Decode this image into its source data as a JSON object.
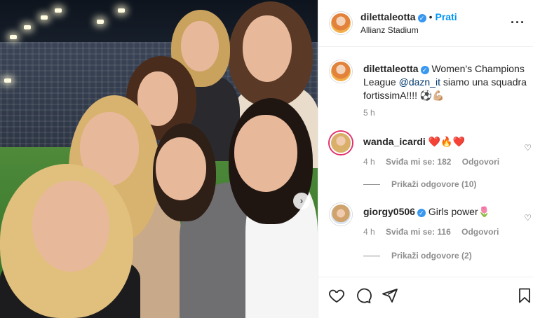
{
  "post": {
    "username": "dilettaleotta",
    "follow_label": "Prati",
    "location": "Allianz Stadium"
  },
  "caption": {
    "username": "dilettaleotta",
    "text_before": "Women's Champions League ",
    "mention": "@dazn_it",
    "text_after": " siamo una squadra fortissimA!!!! ⚽💪🏼",
    "time": "5 h"
  },
  "comments": [
    {
      "username": "wanda_icardi",
      "text": "❤️🔥❤️",
      "time": "4 h",
      "likes_label": "Sviđa mi se: 182",
      "reply_label": "Odgovori",
      "view_replies": "Prikaži odgovore (10)"
    },
    {
      "username": "giorgy0506",
      "text": "Girls power🌷",
      "time": "4 h",
      "likes_label": "Sviđa mi se: 116",
      "reply_label": "Odgovori",
      "view_replies": "Prikaži odgovore (2)"
    }
  ],
  "icons": {
    "like": "heart-icon",
    "comment": "comment-icon",
    "share": "share-icon",
    "save": "bookmark-icon",
    "more": "more-options-icon",
    "verified": "verified-badge-icon",
    "carousel_next": "chevron-right-icon"
  },
  "colors": {
    "link_blue": "#0095f6",
    "verified_blue": "#3897f0",
    "muted": "#8e8e8e",
    "text": "#262626"
  }
}
